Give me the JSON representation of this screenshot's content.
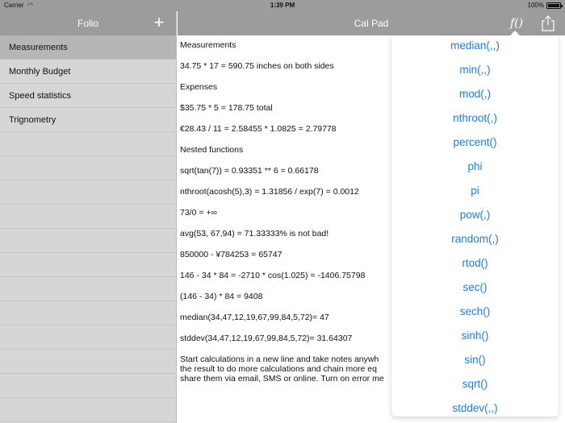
{
  "status_bar": {
    "carrier": "Carrier",
    "time": "1:39 PM",
    "battery": "100%"
  },
  "sidebar": {
    "title": "Folio",
    "items": [
      {
        "label": "Measurements"
      },
      {
        "label": "Monthly Budget"
      },
      {
        "label": "Speed statistics"
      },
      {
        "label": "Trignometry"
      },
      {
        "label": ""
      },
      {
        "label": ""
      },
      {
        "label": ""
      },
      {
        "label": ""
      },
      {
        "label": ""
      },
      {
        "label": ""
      },
      {
        "label": ""
      },
      {
        "label": ""
      },
      {
        "label": ""
      },
      {
        "label": ""
      },
      {
        "label": ""
      },
      {
        "label": ""
      }
    ]
  },
  "main": {
    "title": "Cal Pad",
    "lines": [
      "Measurements",
      "34.75 * 17 = 590.75 inches on both sides",
      "Expenses",
      "$35.75 * 5 = 178.75  total",
      "€28.43 / 11 = 2.58455 * 1.0825 = 2.79778",
      "Nested functions",
      "sqrt(tan(7)) = 0.93351  ** 6 = 0.66178",
      "nthroot(acosh(5),3) = 1.31856  / exp(7) = 0.0012",
      "73/0 = +∞",
      "avg(53, 67,94) = 71.33333% is not bad!",
      "850000 - ¥784253 = 65747",
      "146 - 34 * 84 = -2710 * cos(1.025) = -1406.75798",
      "(146 - 34) * 84 = 9408",
      "median(34,47,12,19,67,99,84,5,72)= 47",
      "stddev(34,47,12,19,67,99,84,5,72)= 31.64307"
    ],
    "paragraph": [
      "Start calculations in a new line and take notes anywh",
      "the result to do more calculations and chain more eq",
      "share them via email, SMS or online. Turn on error me"
    ]
  },
  "functions": {
    "items": [
      "median(,,)",
      "min(,,)",
      "mod(,)",
      "nthroot(,)",
      "percent()",
      "phi",
      "pi",
      "pow(,)",
      "random(,)",
      "rtod()",
      "sec()",
      "sech()",
      "sinh()",
      "sin()",
      "sqrt()",
      "stddev(,,)"
    ]
  },
  "colors": {
    "accent": "#1f7ce0",
    "header": "#9c9c9e",
    "sidebar": "#d6d6d8"
  }
}
